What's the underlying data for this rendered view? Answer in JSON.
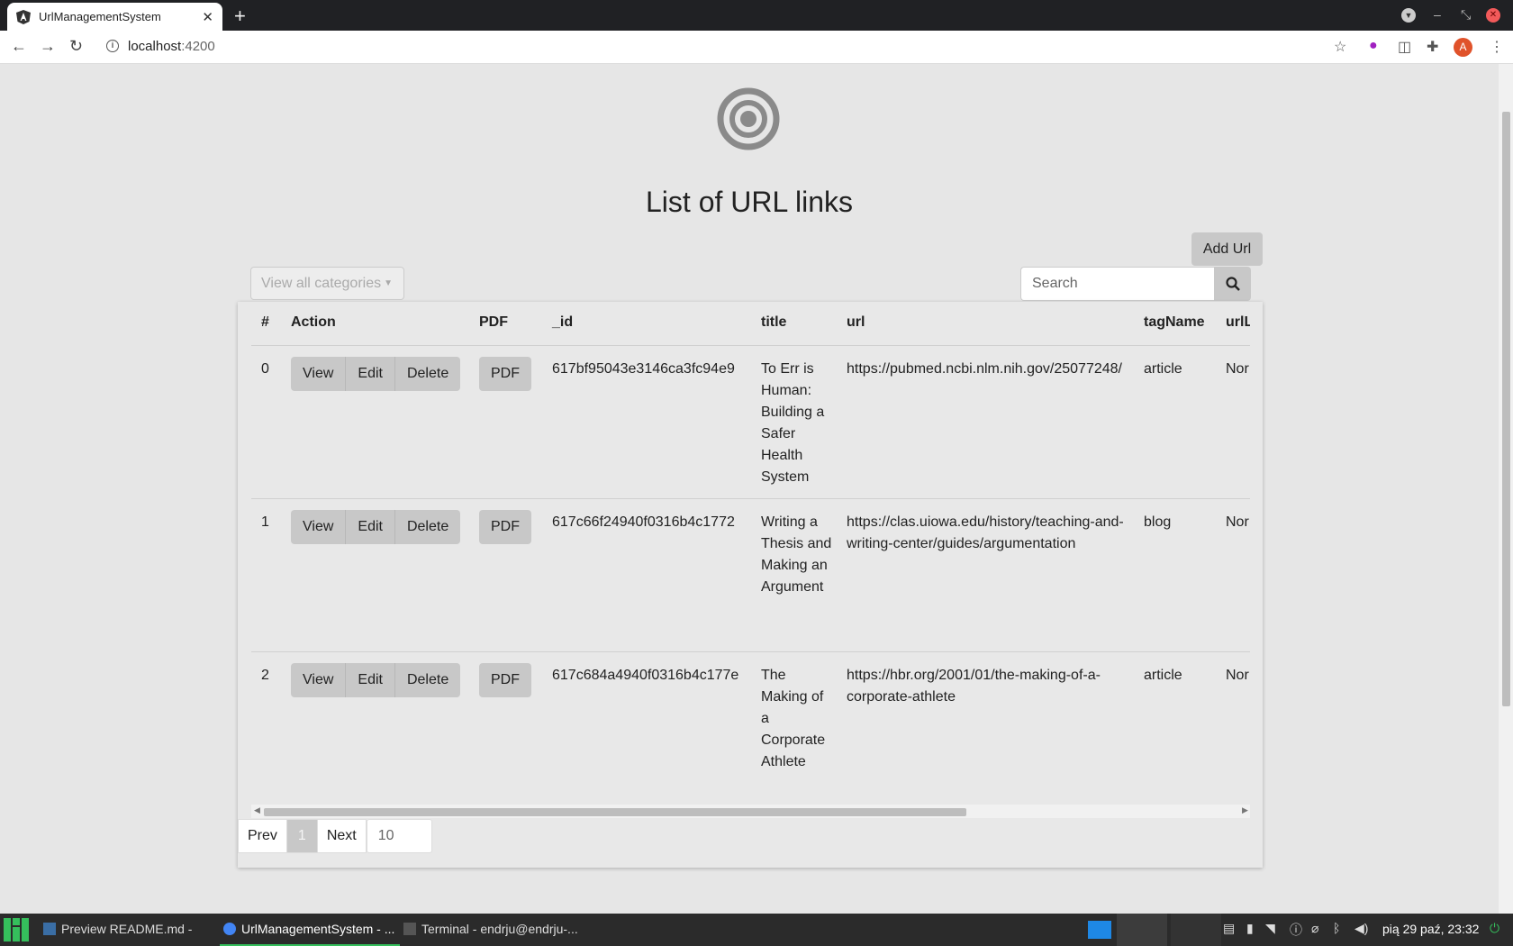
{
  "browser": {
    "tab_title": "UrlManagementSystem",
    "url_host": "localhost",
    "url_port": ":4200"
  },
  "page": {
    "title": "List of URL links",
    "add_button": "Add Url",
    "category_dropdown": "View all categories",
    "search_placeholder": "Search"
  },
  "table": {
    "headers": [
      "#",
      "Action",
      "PDF",
      "_id",
      "title",
      "url",
      "tagName",
      "urlL"
    ],
    "action_labels": {
      "view": "View",
      "edit": "Edit",
      "delete": "Delete",
      "pdf": "PDF"
    },
    "rows": [
      {
        "index": "0",
        "id": "617bf95043e3146ca3fc94e9",
        "title": "To Err is Human: Building a Safer Health System",
        "url": "https://pubmed.ncbi.nlm.nih.gov/25077248/",
        "tagName": "article",
        "urlL": "Nor"
      },
      {
        "index": "1",
        "id": "617c66f24940f0316b4c1772",
        "title": "Writing a Thesis and Making an Argument",
        "url": "https://clas.uiowa.edu/history/teaching-and-writing-center/guides/argumentation",
        "tagName": "blog",
        "urlL": "Nor"
      },
      {
        "index": "2",
        "id": "617c684a4940f0316b4c177e",
        "title": "The Making of a Corporate Athlete",
        "url": "https://hbr.org/2001/01/the-making-of-a-corporate-athlete",
        "tagName": "article",
        "urlL": "Nor"
      }
    ]
  },
  "pagination": {
    "prev": "Prev",
    "current": "1",
    "next": "Next",
    "page_size": "10"
  },
  "taskbar": {
    "tasks": [
      {
        "label": "Preview README.md - Url..."
      },
      {
        "label": "UrlManagementSystem - ..."
      },
      {
        "label": "Terminal - endrju@endrju-..."
      }
    ],
    "clock": "pią 29 paź, 23:32"
  },
  "colors": {
    "page_bg": "#e6e6e6",
    "button_bg": "#c8c8c8",
    "tabstrip_bg": "#202124",
    "taskbar_bg": "#2b2b2b",
    "taskbar_accent": "#35bf5c"
  }
}
